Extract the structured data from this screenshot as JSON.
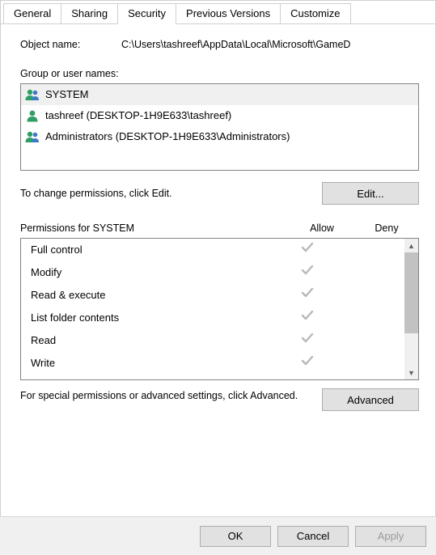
{
  "tabs": [
    {
      "label": "General",
      "active": false
    },
    {
      "label": "Sharing",
      "active": false
    },
    {
      "label": "Security",
      "active": true
    },
    {
      "label": "Previous Versions",
      "active": false
    },
    {
      "label": "Customize",
      "active": false
    }
  ],
  "object": {
    "label": "Object name:",
    "value": "C:\\Users\\tashreef\\AppData\\Local\\Microsoft\\GameD"
  },
  "groupLabel": "Group or user names:",
  "principals": [
    {
      "name": "SYSTEM",
      "icon": "users",
      "selected": true
    },
    {
      "name": "tashreef (DESKTOP-1H9E633\\tashreef)",
      "icon": "user",
      "selected": false
    },
    {
      "name": "Administrators (DESKTOP-1H9E633\\Administrators)",
      "icon": "users",
      "selected": false
    }
  ],
  "editHint": "To change permissions, click Edit.",
  "editBtn": "Edit...",
  "permHeader": {
    "label": "Permissions for SYSTEM",
    "allow": "Allow",
    "deny": "Deny"
  },
  "permissions": [
    {
      "name": "Full control",
      "allow": true,
      "deny": false
    },
    {
      "name": "Modify",
      "allow": true,
      "deny": false
    },
    {
      "name": "Read & execute",
      "allow": true,
      "deny": false
    },
    {
      "name": "List folder contents",
      "allow": true,
      "deny": false
    },
    {
      "name": "Read",
      "allow": true,
      "deny": false
    },
    {
      "name": "Write",
      "allow": true,
      "deny": false
    }
  ],
  "advHint": "For special permissions or advanced settings, click Advanced.",
  "advBtn": "Advanced",
  "footer": {
    "ok": "OK",
    "cancel": "Cancel",
    "apply": "Apply"
  },
  "glyphs": {
    "check": "✓",
    "arrowUp": "▲",
    "arrowDown": "▼"
  }
}
